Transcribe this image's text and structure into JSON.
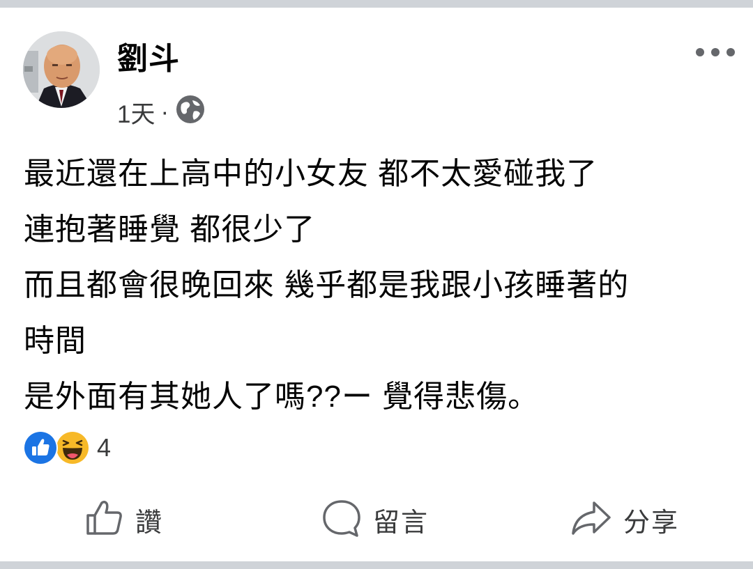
{
  "post": {
    "author": "劉斗",
    "time": "1天",
    "separator": "·",
    "privacy_icon": "globe-icon",
    "lines": [
      "最近還在上高中的小女友 都不太愛碰我了",
      "連抱著睡覺 都很少了",
      "而且都會很晚回來 幾乎都是我跟小孩睡著的",
      "時間",
      "是外面有其她人了嗎??ー  覺得悲傷。"
    ]
  },
  "reactions": {
    "icons": [
      "like-icon",
      "haha-icon"
    ],
    "count": "4"
  },
  "actions": {
    "like": "讚",
    "comment": "留言",
    "share": "分享"
  },
  "colors": {
    "like_blue": "#1b74e4",
    "haha_yellow": "#f7b928",
    "text_secondary": "#65676b",
    "background_gray": "#cfd3d8"
  }
}
